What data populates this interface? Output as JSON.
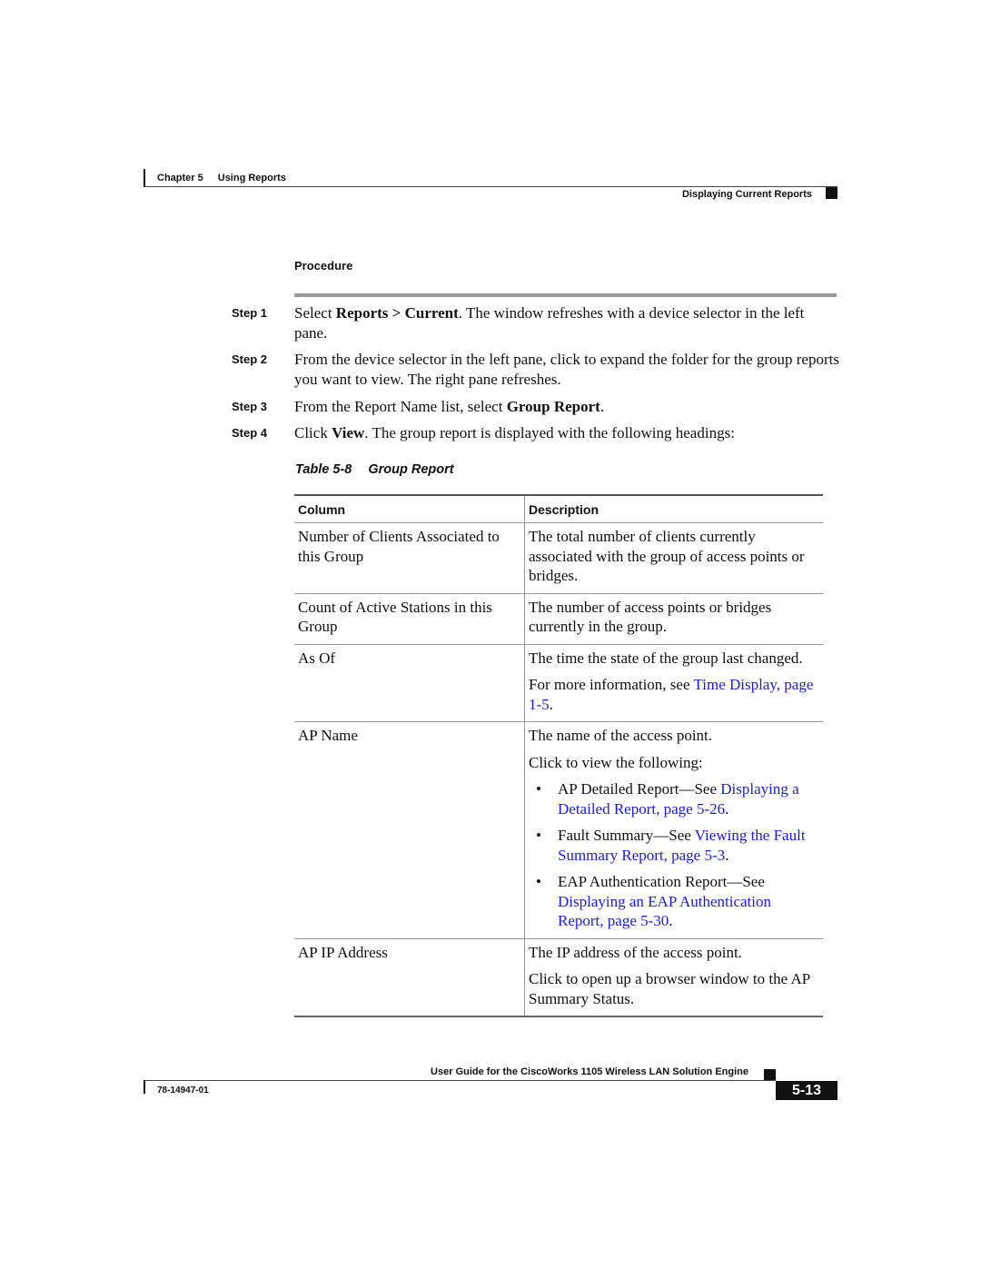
{
  "header": {
    "chapter_label": "Chapter 5",
    "chapter_title": "Using Reports",
    "section_title": "Displaying Current Reports"
  },
  "procedure": {
    "label": "Procedure",
    "steps": [
      {
        "label": "Step 1",
        "parts": [
          "Select ",
          "Reports > Current",
          ". The window refreshes with a device selector in the left pane."
        ]
      },
      {
        "label": "Step 2",
        "parts": [
          "From the device selector in the left pane, click to expand the folder for the group reports you want to view. The right pane refreshes."
        ]
      },
      {
        "label": "Step 3",
        "parts": [
          "From the Report Name list, select ",
          "Group Report",
          "."
        ]
      },
      {
        "label": "Step 4",
        "parts": [
          "Click ",
          "View",
          ". The group report is displayed with the following headings:"
        ]
      }
    ]
  },
  "table": {
    "caption_number": "Table 5-8",
    "caption_title": "Group Report",
    "headers": [
      "Column",
      "Description"
    ],
    "rows": [
      {
        "column": "Number of Clients Associated to this Group",
        "description": "The total number of clients currently associated with the group of access points or bridges."
      },
      {
        "column": "Count of Active Stations in this Group",
        "description": "The number of access points or bridges currently in the group."
      },
      {
        "column": "As Of",
        "description": "The time the state of the group last changed.",
        "more_prefix": "For more information, see ",
        "more_link": "Time Display, page 1-5",
        "more_suffix": "."
      },
      {
        "column": "AP Name",
        "description": "The name of the access point.",
        "intro": "Click to view the following:",
        "bullets": [
          {
            "text": "AP Detailed Report—See ",
            "link": "Displaying a Detailed Report, page 5-26",
            "suffix": "."
          },
          {
            "text": "Fault Summary—See ",
            "link": "Viewing the Fault Summary Report, page 5-3",
            "suffix": "."
          },
          {
            "text": "EAP Authentication Report—See ",
            "link": "Displaying an EAP Authentication Report, page 5-30",
            "suffix": "."
          }
        ]
      },
      {
        "column": "AP IP Address",
        "description": "The IP address of the access point.",
        "extra": "Click to open up a browser window to the AP Summary Status."
      }
    ]
  },
  "footer": {
    "guide_title": "User Guide for the CiscoWorks 1105 Wireless LAN Solution Engine",
    "doc_number": "78-14947-01",
    "page_number": "5-13"
  },
  "colors": {
    "link": "#1a1aee",
    "text": "#111111",
    "rule_gray": "#999999"
  }
}
